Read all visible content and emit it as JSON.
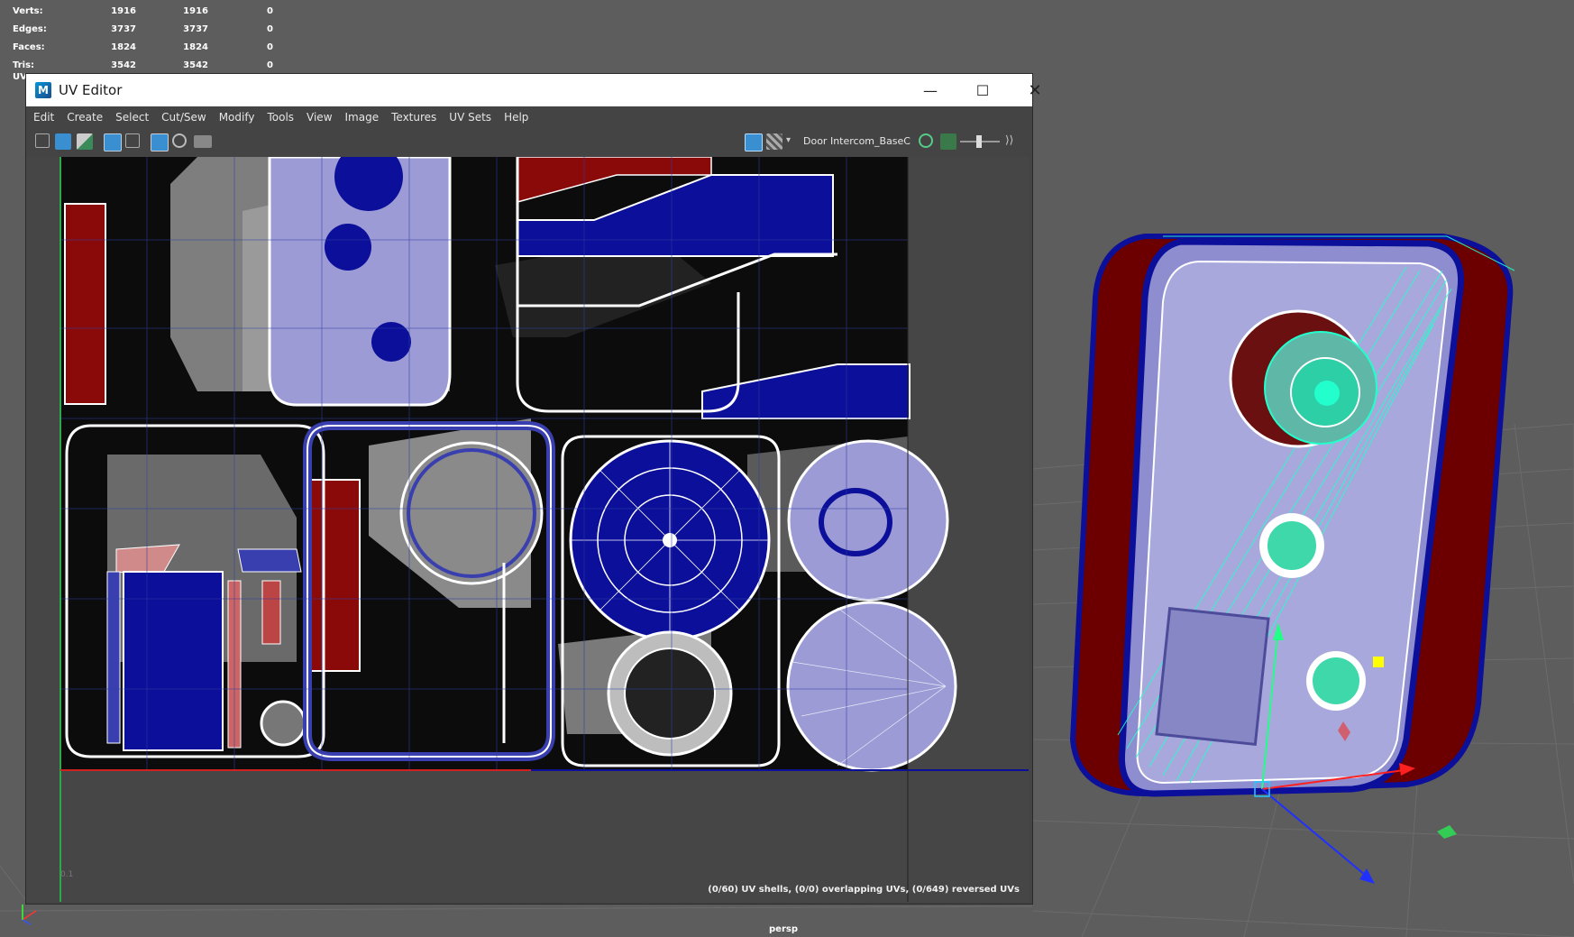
{
  "hud": {
    "rows": [
      {
        "label": "Verts:",
        "v1": "1916",
        "v2": "1916",
        "v3": "0"
      },
      {
        "label": "Edges:",
        "v1": "3737",
        "v2": "3737",
        "v3": "0"
      },
      {
        "label": "Faces:",
        "v1": "1824",
        "v2": "1824",
        "v3": "0"
      },
      {
        "label": "Tris:",
        "v1": "3542",
        "v2": "3542",
        "v3": "0"
      }
    ],
    "extra_label": "UV"
  },
  "uv_editor": {
    "title": "UV Editor",
    "app_icon": "M",
    "window_controls": {
      "minimize_icon": "minimize-icon",
      "maximize_icon": "maximize-icon",
      "close_icon": "close-icon"
    },
    "menu": [
      "Edit",
      "Create",
      "Select",
      "Cut/Sew",
      "Modify",
      "Tools",
      "View",
      "Image",
      "Textures",
      "UV Sets",
      "Help"
    ],
    "texture_name": "Door Intercom_BaseC",
    "status": "(0/60) UV shells, (0/0) overlapping UVs, (0/649) reversed UVs",
    "axis_value": "0.1"
  },
  "viewport": {
    "camera_label": "persp"
  },
  "colors": {
    "uv_blue": "#0b0f9a",
    "uv_red": "#8a0a0a",
    "wire": "#ffffff",
    "selection": "#22ffcc",
    "bg_grid": "#5d5d5d"
  }
}
